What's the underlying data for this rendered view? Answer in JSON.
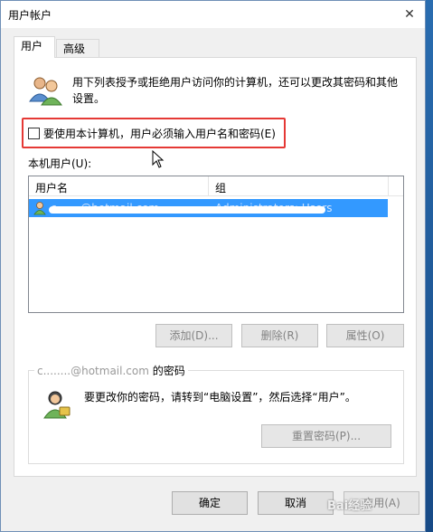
{
  "window": {
    "title": "用户帐户",
    "close_glyph": "✕"
  },
  "tabs": [
    {
      "label": "用户",
      "active": true
    },
    {
      "label": "高级",
      "active": false
    }
  ],
  "intro": {
    "text": "用下列表授予或拒绝用户访问你的计算机，还可以更改其密码和其他设置。"
  },
  "require_login": {
    "label": "要使用本计算机，用户必须输入用户名和密码(E)",
    "checked": false
  },
  "users_list": {
    "label": "本机用户(U):",
    "columns": [
      "用户名",
      "组"
    ],
    "rows": [
      {
        "name": "c.......@hotmail.com",
        "group": "Administrators; Users",
        "selected": true
      }
    ]
  },
  "user_buttons": {
    "add": "添加(D)...",
    "remove": "删除(R)",
    "properties": "属性(O)"
  },
  "password_group": {
    "title_prefix": "c........@hotmail.com",
    "title_suffix": " 的密码",
    "text": "要更改你的密码，请转到“电脑设置”，然后选择“用户”。",
    "reset_button": "重置密码(P)..."
  },
  "footer": {
    "ok": "确定",
    "cancel": "取消",
    "apply": "应用(A)"
  },
  "watermark": "Bai经验",
  "colors": {
    "selection": "#3399ff",
    "highlight_border": "#e53935"
  }
}
